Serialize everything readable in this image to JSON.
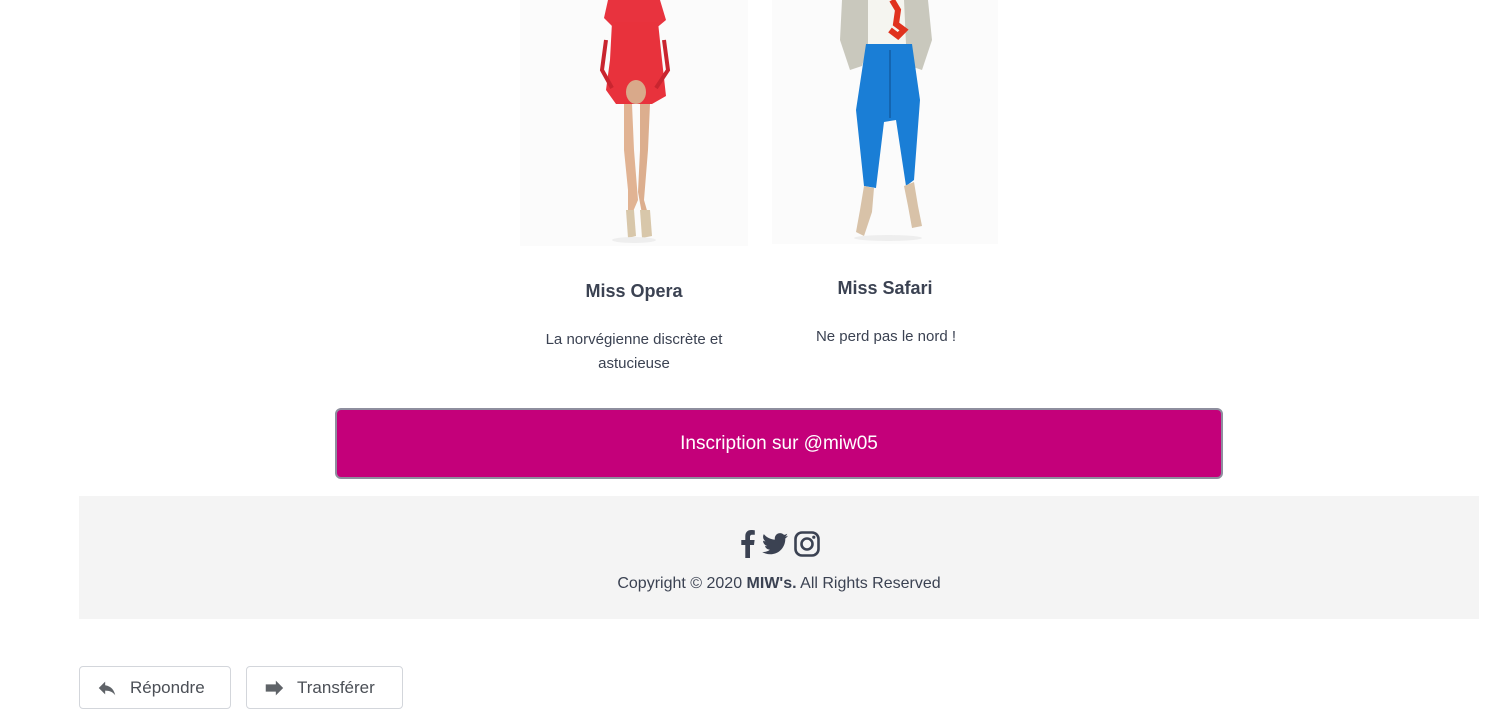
{
  "products": [
    {
      "name": "Miss Opera",
      "description": "La norvégienne discrète et astucieuse",
      "image_icon": "model-red-dress-image"
    },
    {
      "name": "Miss Safari",
      "description": "Ne perd pas le nord !",
      "image_icon": "model-blue-pants-image"
    }
  ],
  "cta": {
    "label": "Inscription sur @miw05",
    "color": "#c4007a"
  },
  "footer": {
    "social_icons": [
      "facebook-icon",
      "twitter-icon",
      "instagram-icon"
    ],
    "copyright_prefix": "Copyright © 2020",
    "copyright_brand": "MIW's.",
    "copyright_suffix": "All Rights Reserved"
  },
  "actions": {
    "reply_label": "Répondre",
    "forward_label": "Transférer"
  }
}
